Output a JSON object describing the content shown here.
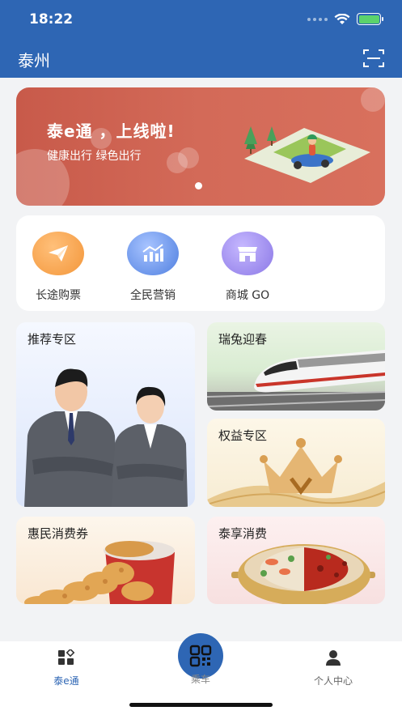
{
  "status_bar": {
    "time": "18:22"
  },
  "header": {
    "city": "泰州"
  },
  "banner": {
    "title": "泰e通 ，上线啦!",
    "subtitle": "健康出行  绿色出行"
  },
  "quick_actions": [
    {
      "label": "长途购票",
      "icon": "paper-plane-icon",
      "color": "#f39a3b"
    },
    {
      "label": "全民营销",
      "icon": "chart-icon",
      "color": "#4f7fe0"
    },
    {
      "label": "商城 GO",
      "icon": "shop-icon",
      "color": "#8b78e6"
    }
  ],
  "tiles": {
    "recommend": "推荐专区",
    "rabbit": "瑞兔迎春",
    "rights": "权益专区",
    "coupon": "惠民消费券",
    "consume": "泰享消费"
  },
  "tab_bar": {
    "home": "泰e通",
    "ride": "乘车",
    "profile": "个人中心"
  },
  "colors": {
    "primary": "#2e66b4",
    "active_tab": "#2e66b4",
    "inactive_tab": "#888888"
  }
}
